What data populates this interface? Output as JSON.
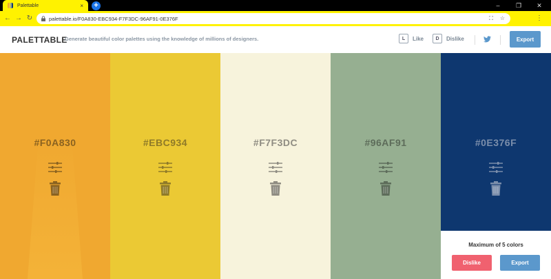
{
  "browser": {
    "tab_title": "Palettable",
    "url": "palettable.io/F0A830-EBC934-F7F3DC-96AF91-0E376F",
    "new_tab_label": "+",
    "min_label": "–",
    "max_label": "❐",
    "close_label": "✕",
    "tab_close_label": "×"
  },
  "header": {
    "logo": "PALETTABLE",
    "tagline": "Generate beautiful color palettes using the knowledge of millions of designers.",
    "like_key": "L",
    "like_label": "Like",
    "dislike_key": "D",
    "dislike_label": "Dislike",
    "export_label": "Export"
  },
  "palette": {
    "colors": [
      {
        "hex": "#F0A830",
        "bg": "#F0A830",
        "text": "#8a6220"
      },
      {
        "hex": "#EBC934",
        "bg": "#EBC934",
        "text": "#8f7a28"
      },
      {
        "hex": "#F7F3DC",
        "bg": "#F7F3DC",
        "text": "#8f8c82"
      },
      {
        "hex": "#96AF91",
        "bg": "#96AF91",
        "text": "#5d6c5a"
      },
      {
        "hex": "#0E376F",
        "bg": "#0E376F",
        "text": "#7b8eab"
      }
    ]
  },
  "limit_panel": {
    "message": "Maximum of 5 colors",
    "dislike_label": "Dislike",
    "export_label": "Export",
    "dislike_color": "#f0616f",
    "export_color": "#5b98cc"
  }
}
